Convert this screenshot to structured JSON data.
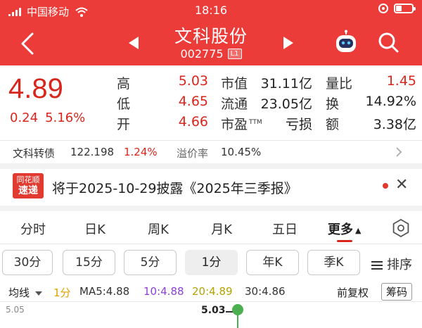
{
  "status_bar": {
    "carrier": "中国移动",
    "time": "18:16",
    "battery_level": 0.35
  },
  "header": {
    "title": "文科股份",
    "code": "002775",
    "badge": "L1"
  },
  "quote": {
    "price": "4.89",
    "change": "0.24",
    "change_pct": "5.16%",
    "high_label": "高",
    "high": "5.03",
    "low_label": "低",
    "low": "4.65",
    "open_label": "开",
    "open": "4.66",
    "mktcap_label": "市值",
    "mktcap": "31.11亿",
    "float_label": "流通",
    "float": "23.05亿",
    "pe_label": "市盈",
    "pe_tm": "TTM",
    "pe": "亏损",
    "volratio_label": "量比",
    "volratio": "1.45",
    "turnover_label": "换",
    "turnover": "14.92%",
    "amount_label": "额",
    "amount": "3.38亿"
  },
  "bond": {
    "label": "文科转债",
    "price": "122.198",
    "pct": "1.24%",
    "premium_label": "溢价率",
    "premium": "10.45%"
  },
  "news": {
    "logo_line1": "同花顺",
    "logo_line2": "速递",
    "text": "将于2025-10-29披露《2025年三季报》"
  },
  "tabs": [
    "分时",
    "日K",
    "周K",
    "月K",
    "五日",
    "更多"
  ],
  "minute_buttons": [
    "30分",
    "15分",
    "5分",
    "1分",
    "年K",
    "季K"
  ],
  "sort_label": "排序",
  "indicator": {
    "selector": "均线",
    "period": "1分",
    "ma5": "MA5:4.88",
    "ma10": "10:4.88",
    "ma20": "20:4.89",
    "ma30": "30:4.86",
    "adjust": "前复权",
    "chip": "筹码"
  },
  "chart": {
    "axis_max": "5.05",
    "high_marker": "5.03"
  },
  "colors": {
    "header_red": "#ec3c3a",
    "up_red": "#d9261c",
    "period_orange": "#e0a000",
    "ma10_purple": "#8e3fd6",
    "ma20_olive": "#b4a200",
    "dot_green": "#4caf50"
  }
}
